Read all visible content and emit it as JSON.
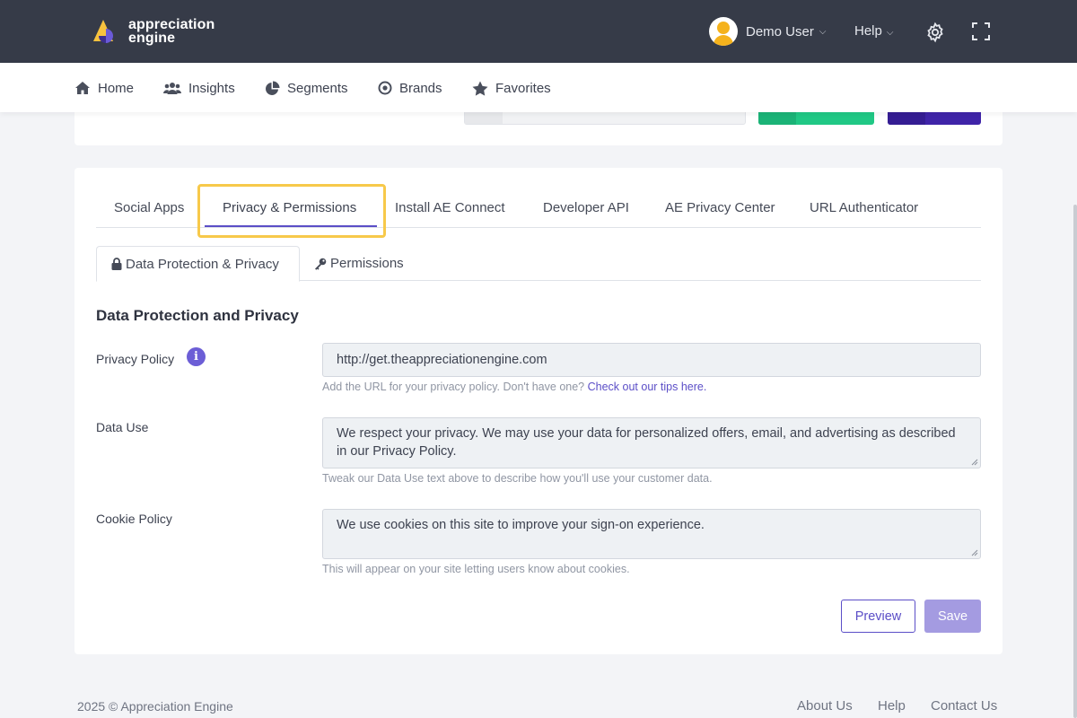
{
  "brand": {
    "logo_line1": "appreciation",
    "logo_line2": "engine"
  },
  "header": {
    "user_name": "Demo User",
    "help_label": "Help"
  },
  "nav": {
    "items": [
      {
        "label": "Home",
        "icon": "home-icon"
      },
      {
        "label": "Insights",
        "icon": "users-icon"
      },
      {
        "label": "Segments",
        "icon": "pie-chart-icon"
      },
      {
        "label": "Brands",
        "icon": "target-icon"
      },
      {
        "label": "Favorites",
        "icon": "star-icon"
      }
    ]
  },
  "tabs": [
    {
      "label": "Social Apps"
    },
    {
      "label": "Privacy & Permissions",
      "active": true
    },
    {
      "label": "Install AE Connect"
    },
    {
      "label": "Developer API"
    },
    {
      "label": "AE Privacy Center"
    },
    {
      "label": "URL Authenticator"
    }
  ],
  "subtabs": [
    {
      "label": "Data Protection & Privacy",
      "icon": "lock-icon",
      "active": true
    },
    {
      "label": "Permissions",
      "icon": "key-icon"
    }
  ],
  "section_title": "Data Protection and Privacy",
  "fields": {
    "privacy_policy": {
      "label": "Privacy Policy",
      "value": "http://get.theappreciationengine.com",
      "help": "Add the URL for your privacy policy. Don't have one?",
      "help_link": "Check out our tips here."
    },
    "data_use": {
      "label": "Data Use",
      "value": "We respect your privacy. We may use your data for personalized offers, email, and advertising as described in our Privacy Policy.",
      "help": "Tweak our Data Use text above to describe how you'll use your customer data."
    },
    "cookie_policy": {
      "label": "Cookie Policy",
      "value": "We use cookies on this site to improve your sign-on experience.",
      "help": "This will appear on your site letting users know about cookies."
    }
  },
  "buttons": {
    "preview": "Preview",
    "save": "Save"
  },
  "footer": {
    "copyright": "2025 © Appreciation Engine",
    "links": [
      "About Us",
      "Help",
      "Contact Us"
    ]
  },
  "colors": {
    "topbar": "#363b48",
    "accent": "#5b4ec7",
    "save_disabled": "#a49be1",
    "highlight": "#f7c94a"
  }
}
